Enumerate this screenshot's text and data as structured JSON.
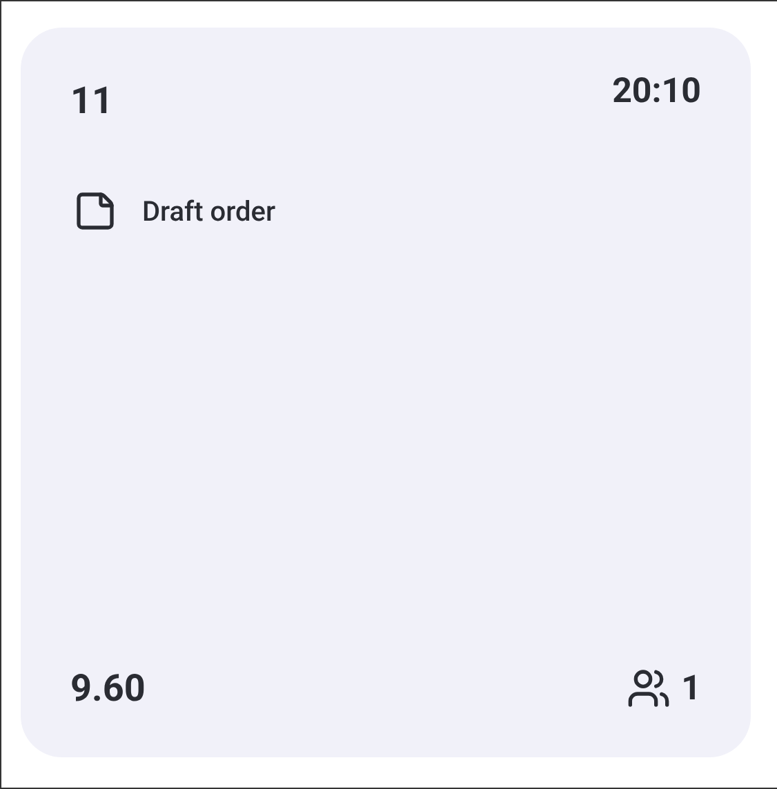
{
  "card": {
    "number": "11",
    "time": "20:10",
    "status": "Draft order",
    "total": "9.60",
    "guests": "1"
  }
}
